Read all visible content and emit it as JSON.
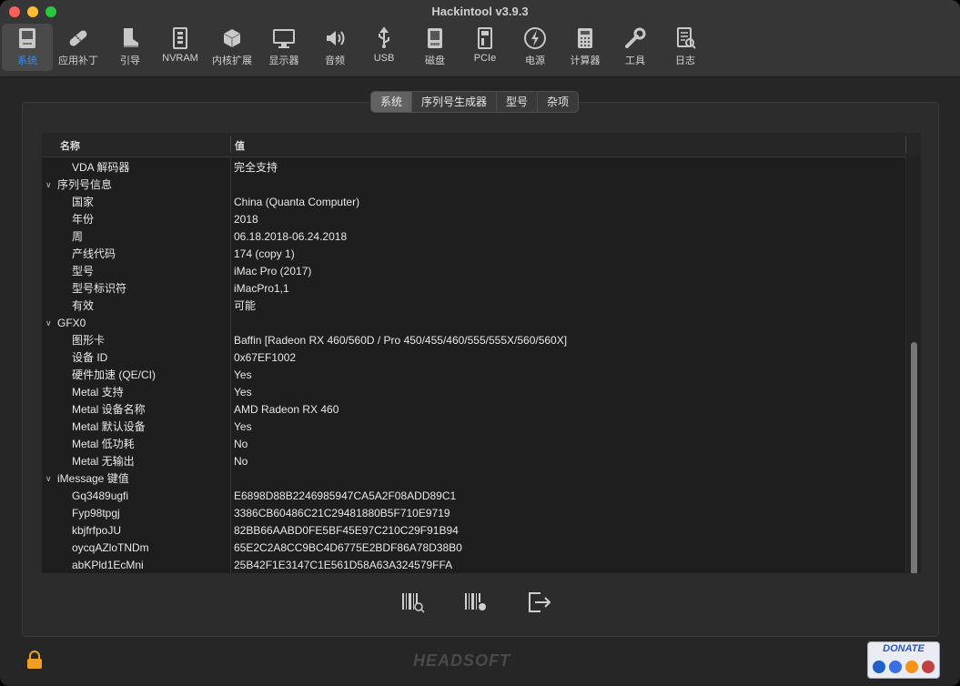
{
  "window": {
    "title": "Hackintool v3.9.3"
  },
  "toolbar": [
    {
      "label": "系统",
      "icon": "mac-icon",
      "active": true
    },
    {
      "label": "应用补丁",
      "icon": "bandage-icon"
    },
    {
      "label": "引导",
      "icon": "boot-icon"
    },
    {
      "label": "NVRAM",
      "icon": "nvram-icon"
    },
    {
      "label": "内核扩展",
      "icon": "kext-icon"
    },
    {
      "label": "显示器",
      "icon": "display-icon"
    },
    {
      "label": "音频",
      "icon": "audio-icon"
    },
    {
      "label": "USB",
      "icon": "usb-icon"
    },
    {
      "label": "磁盘",
      "icon": "disk-icon"
    },
    {
      "label": "PCIe",
      "icon": "pcie-icon"
    },
    {
      "label": "电源",
      "icon": "power-icon"
    },
    {
      "label": "计算器",
      "icon": "calculator-icon"
    },
    {
      "label": "工具",
      "icon": "tools-icon"
    },
    {
      "label": "日志",
      "icon": "log-icon"
    }
  ],
  "tabs": [
    {
      "label": "系统",
      "active": true
    },
    {
      "label": "序列号生成器"
    },
    {
      "label": "型号"
    },
    {
      "label": "杂项"
    }
  ],
  "table": {
    "headers": {
      "name": "名称",
      "value": "值"
    },
    "rows": [
      {
        "name": "VDA 解码器",
        "value": "完全支持"
      },
      {
        "name": "序列号信息",
        "group": true
      },
      {
        "name": "国家",
        "value": "China (Quanta Computer)"
      },
      {
        "name": "年份",
        "value": "2018"
      },
      {
        "name": "周",
        "value": "06.18.2018-06.24.2018"
      },
      {
        "name": "产线代码",
        "value": "174 (copy 1)"
      },
      {
        "name": "型号",
        "value": "iMac Pro (2017)"
      },
      {
        "name": "型号标识符",
        "value": "iMacPro1,1"
      },
      {
        "name": "有效",
        "value": "可能"
      },
      {
        "name": "GFX0",
        "group": true
      },
      {
        "name": "图形卡",
        "value": "Baffin [Radeon RX 460/560D / Pro 450/455/460/555/555X/560/560X]"
      },
      {
        "name": "设备 ID",
        "value": "0x67EF1002"
      },
      {
        "name": "硬件加速 (QE/CI)",
        "value": "Yes"
      },
      {
        "name": "Metal 支持",
        "value": "Yes"
      },
      {
        "name": "Metal 设备名称",
        "value": "AMD Radeon RX 460"
      },
      {
        "name": "Metal 默认设备",
        "value": "Yes"
      },
      {
        "name": "Metal 低功耗",
        "value": "No"
      },
      {
        "name": "Metal 无输出",
        "value": "No"
      },
      {
        "name": "iMessage 键值",
        "group": true
      },
      {
        "name": "Gq3489ugfi",
        "value": "E6898D88B2246985947CA5A2F08ADD89C1"
      },
      {
        "name": "Fyp98tpgj",
        "value": "3386CB60486C21C29481880B5F710E9719"
      },
      {
        "name": "kbjfrfpoJU",
        "value": "82BB66AABD0FE5BF45E97C210C29F91B94"
      },
      {
        "name": "oycqAZloTNDm",
        "value": "65E2C2A8CC9BC4D6775E2BDF86A78D38B0"
      },
      {
        "name": "abKPld1EcMni",
        "value": "25B42F1E3147C1E561D58A63A324579FFA"
      }
    ]
  },
  "footer": {
    "logo": "HEADSOFT",
    "donate": "DONATE",
    "colors": {
      "accent": "#2f8cff",
      "paypal": "#1f5fc7",
      "eth": "#3b6ee0",
      "btc": "#f7931a",
      "other": "#c24040"
    }
  }
}
